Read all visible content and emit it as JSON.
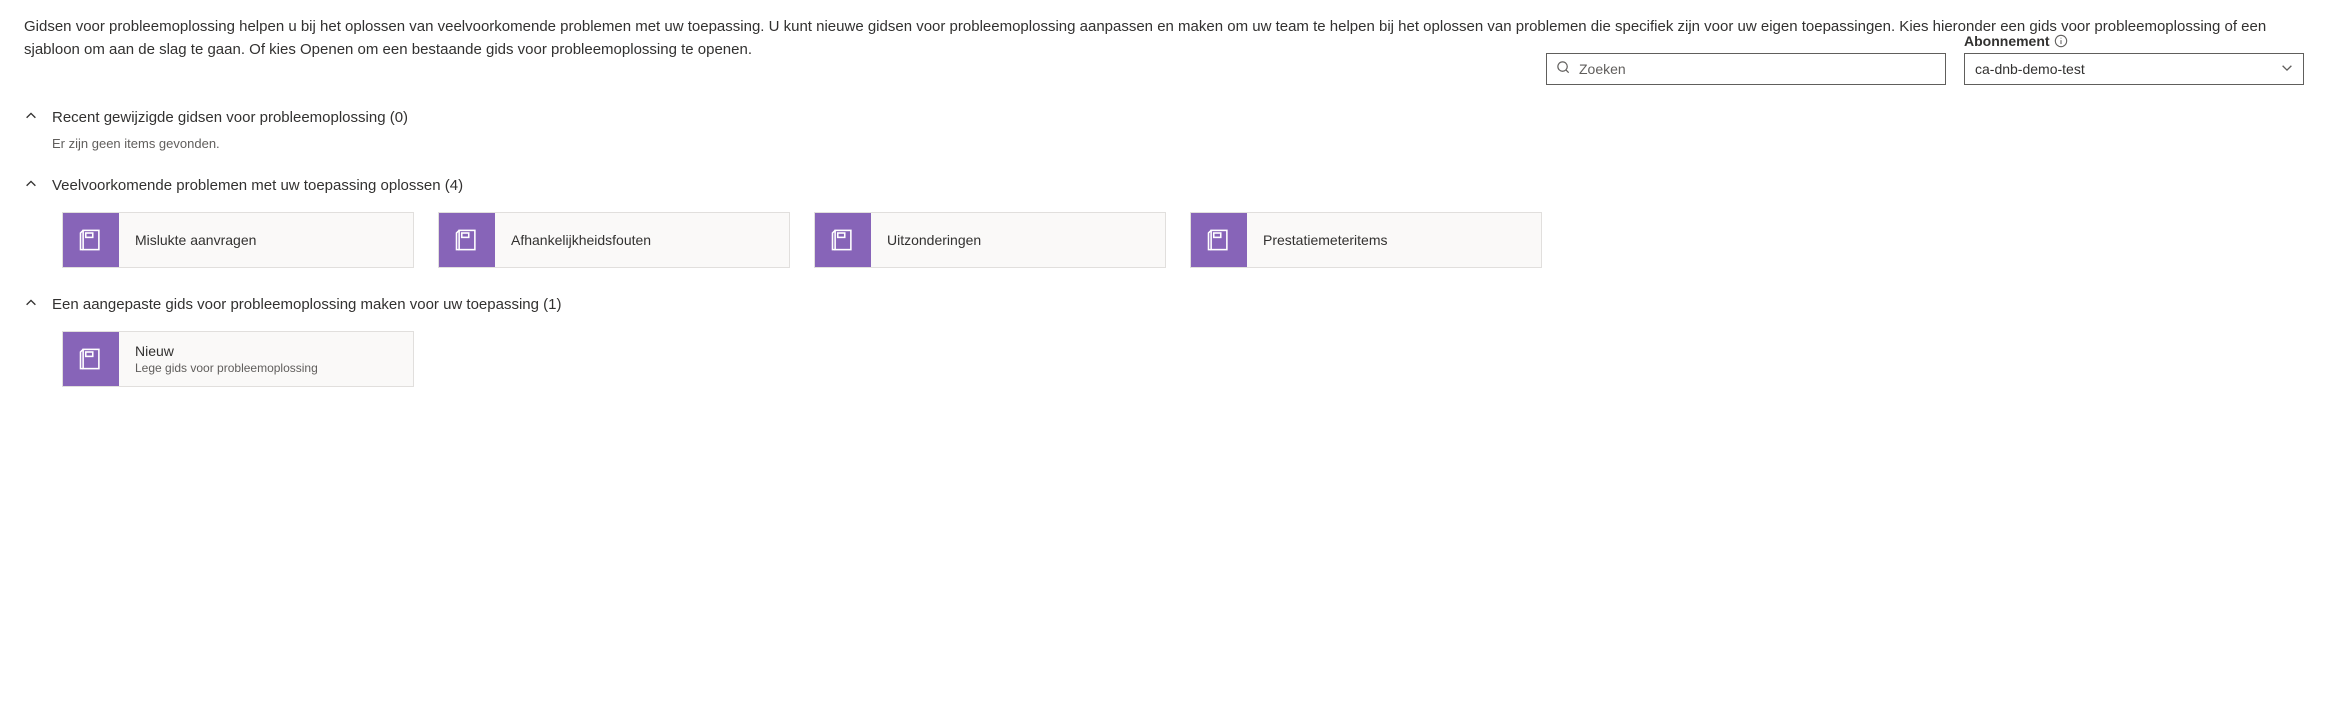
{
  "intro": "Gidsen voor probleemoplossing helpen u bij het oplossen van veelvoorkomende problemen met uw toepassing. U kunt nieuwe gidsen voor probleemoplossing aanpassen en maken om uw team te helpen bij het oplossen van problemen die specifiek zijn voor uw eigen toepassingen. Kies hieronder een gids voor probleemoplossing of een sjabloon om aan de slag te gaan. Of kies Openen om een bestaande gids voor probleemoplossing te openen.",
  "search": {
    "placeholder": "Zoeken"
  },
  "subscription": {
    "label": "Abonnement",
    "value": "ca-dnb-demo-test"
  },
  "sections": {
    "recent": {
      "title": "Recent gewijzigde gidsen voor probleemoplossing (0)",
      "empty": "Er zijn geen items gevonden."
    },
    "common": {
      "title": "Veelvoorkomende problemen met uw toepassing oplossen (4)",
      "items": [
        {
          "title": "Mislukte aanvragen"
        },
        {
          "title": "Afhankelijkheidsfouten"
        },
        {
          "title": "Uitzonderingen"
        },
        {
          "title": "Prestatiemeteritems"
        }
      ]
    },
    "custom": {
      "title": "Een aangepaste gids voor probleemoplossing maken voor uw toepassing (1)",
      "items": [
        {
          "title": "Nieuw",
          "subtitle": "Lege gids voor probleemoplossing"
        }
      ]
    }
  }
}
